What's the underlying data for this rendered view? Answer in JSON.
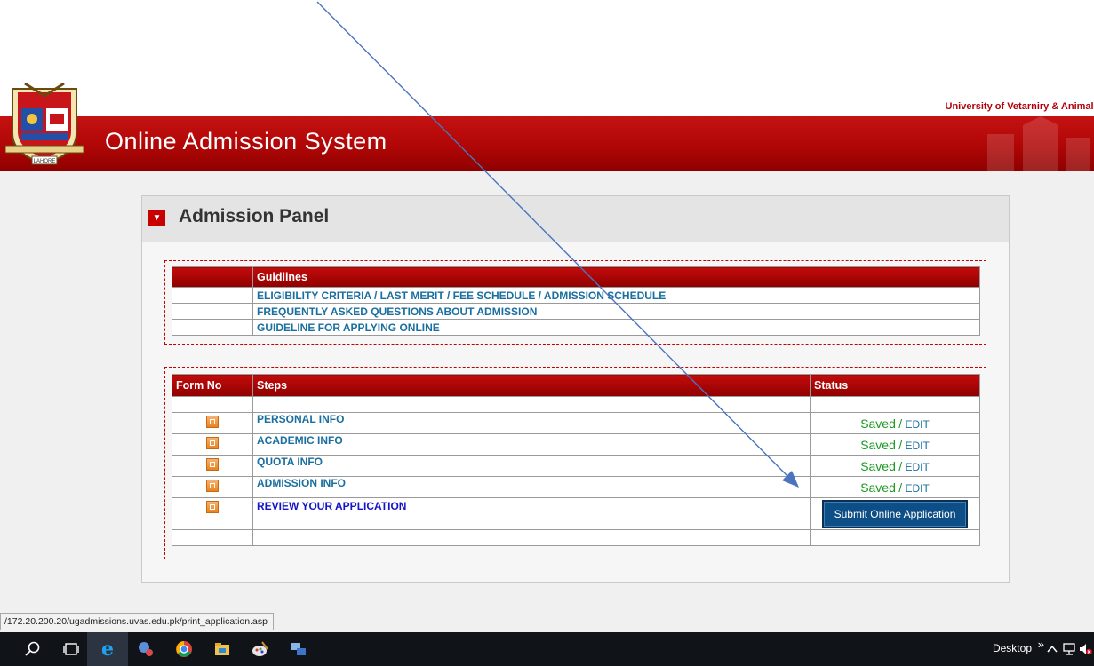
{
  "header": {
    "university_name": "University of Vetarniry & Animal S",
    "banner_title": "Online Admission System",
    "crest_text": "LAHORE"
  },
  "panel": {
    "title": "Admission Panel"
  },
  "guidelines": {
    "header": "Guidlines",
    "links": [
      "ELIGIBILITY CRITERIA / LAST MERIT / FEE SCHEDULE / ADMISSION SCHEDULE",
      "FREQUENTLY ASKED QUESTIONS ABOUT ADMISSION",
      "GUIDELINE FOR APPLYING ONLINE"
    ]
  },
  "steps_table": {
    "headers": {
      "form_no": "Form No",
      "steps": "Steps",
      "status": "Status"
    },
    "rows": [
      {
        "step": "PERSONAL INFO",
        "status": "Saved",
        "separator": "/",
        "edit": "EDIT"
      },
      {
        "step": "ACADEMIC INFO",
        "status": "Saved",
        "separator": "/",
        "edit": "EDIT"
      },
      {
        "step": "QUOTA INFO",
        "status": "Saved",
        "separator": "/",
        "edit": "EDIT"
      },
      {
        "step": "ADMISSION INFO",
        "status": "Saved",
        "separator": "/",
        "edit": "EDIT"
      }
    ],
    "review_label": "REVIEW YOUR APPLICATION",
    "submit_label": "Submit Online Application"
  },
  "status_bar": {
    "url": "/172.20.200.20/ugadmissions.uvas.edu.pk/print_application.asp"
  },
  "taskbar": {
    "desktop_label": "Desktop",
    "chevron": "»"
  },
  "colors": {
    "brand_red": "#b00606",
    "link": "#1a6fa0",
    "saved_green": "#1b9a22",
    "submit_blue": "#0d4e86"
  },
  "icons": [
    "search-icon",
    "task-view-icon",
    "internet-explorer-icon",
    "app-icon",
    "chrome-icon",
    "file-explorer-icon",
    "paint-icon",
    "network-app-icon",
    "tray-up-icon",
    "network-icon",
    "volume-muted-icon"
  ]
}
